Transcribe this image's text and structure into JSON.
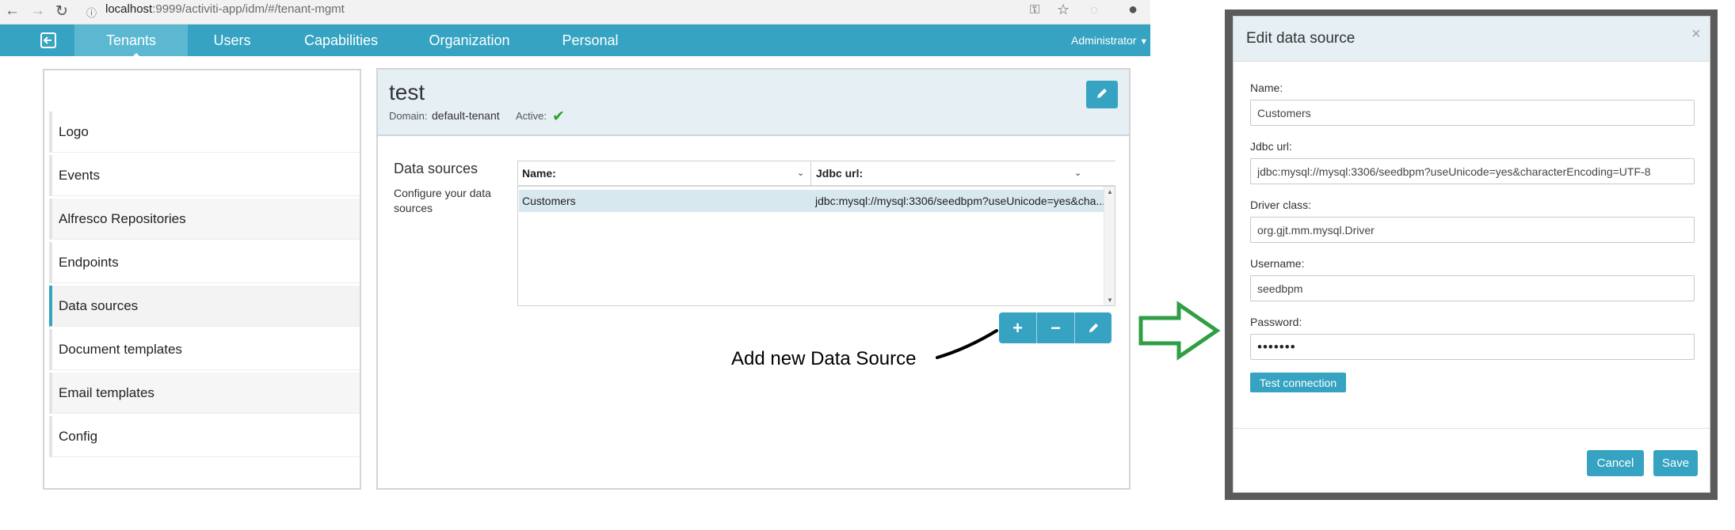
{
  "browser": {
    "url_host": "localhost",
    "url_path": ":9999/activiti-app/idm/#/tenant-mgmt"
  },
  "nav": {
    "tabs": [
      {
        "label": "Tenants"
      },
      {
        "label": "Users"
      },
      {
        "label": "Capabilities"
      },
      {
        "label": "Organization"
      },
      {
        "label": "Personal"
      }
    ],
    "user": "Administrator"
  },
  "sidebar": {
    "items": [
      {
        "label": "Logo"
      },
      {
        "label": "Events"
      },
      {
        "label": "Alfresco Repositories"
      },
      {
        "label": "Endpoints"
      },
      {
        "label": "Data sources"
      },
      {
        "label": "Document templates"
      },
      {
        "label": "Email templates"
      },
      {
        "label": "Config"
      }
    ]
  },
  "tenant": {
    "name": "test",
    "domain_label": "Domain:",
    "domain_value": "default-tenant",
    "active_label": "Active:"
  },
  "datasources": {
    "heading": "Data sources",
    "subtitle": "Configure your data sources",
    "columns": [
      "Name:",
      "Jdbc url:"
    ],
    "rows": [
      {
        "name": "Customers",
        "url": "jdbc:mysql://mysql:3306/seedbpm?useUnicode=yes&cha..."
      }
    ]
  },
  "annotation": "Add new Data Source",
  "modal": {
    "title": "Edit data source",
    "close": "×",
    "fields": [
      {
        "label": "Name:",
        "value": "Customers"
      },
      {
        "label": "Jdbc url:",
        "value": "jdbc:mysql://mysql:3306/seedbpm?useUnicode=yes&characterEncoding=UTF-8"
      },
      {
        "label": "Driver class:",
        "value": "org.gjt.mm.mysql.Driver"
      },
      {
        "label": "Username:",
        "value": "seedbpm"
      },
      {
        "label": "Password:",
        "value": "•••••••"
      }
    ],
    "test_button": "Test connection",
    "cancel_button": "Cancel",
    "save_button": "Save"
  },
  "colors": {
    "accent": "#35a3c1",
    "nav_active": "#5cb8d1",
    "header_bg": "#e6eff4",
    "arrow": "#2f9e44",
    "check": "#2f9e2f"
  }
}
